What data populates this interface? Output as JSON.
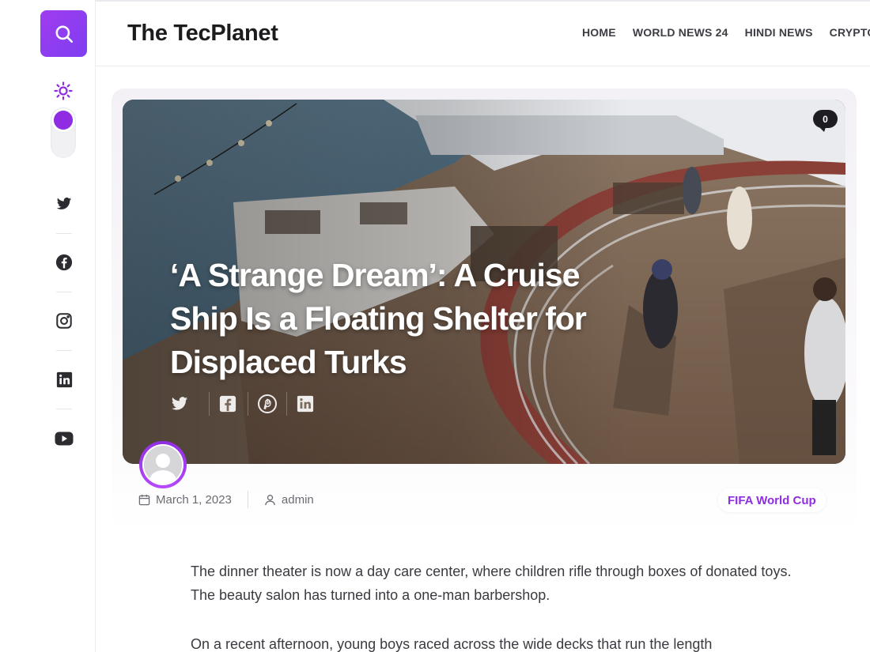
{
  "site": {
    "title": "The TecPlanet"
  },
  "nav": {
    "items": [
      "HOME",
      "WORLD NEWS 24",
      "HINDI NEWS",
      "CRYPTO"
    ]
  },
  "sidebar": {
    "search_icon": "search-icon",
    "theme_icon": "sun-icon",
    "social": [
      "twitter-icon",
      "facebook-icon",
      "instagram-icon",
      "linkedin-icon",
      "youtube-icon"
    ]
  },
  "post": {
    "title": "‘A Strange Dream’: A Cruise Ship Is a Floating Shelter for Displaced Turks",
    "comments": "0",
    "date": "March 1, 2023",
    "author": "admin",
    "category": "FIFA World Cup",
    "share_icons": [
      "twitter-icon",
      "facebook-icon",
      "pinterest-icon",
      "linkedin-icon"
    ]
  },
  "article": {
    "paragraphs": [
      "The dinner theater is now a day care center, where children rifle through boxes of donated toys. The beauty salon has turned into a one-man barbershop.",
      "On a recent afternoon, young boys raced across the wide decks that run the length"
    ]
  },
  "colors": {
    "accent": "#8e2de2",
    "accent_end": "#7d3ff0"
  }
}
